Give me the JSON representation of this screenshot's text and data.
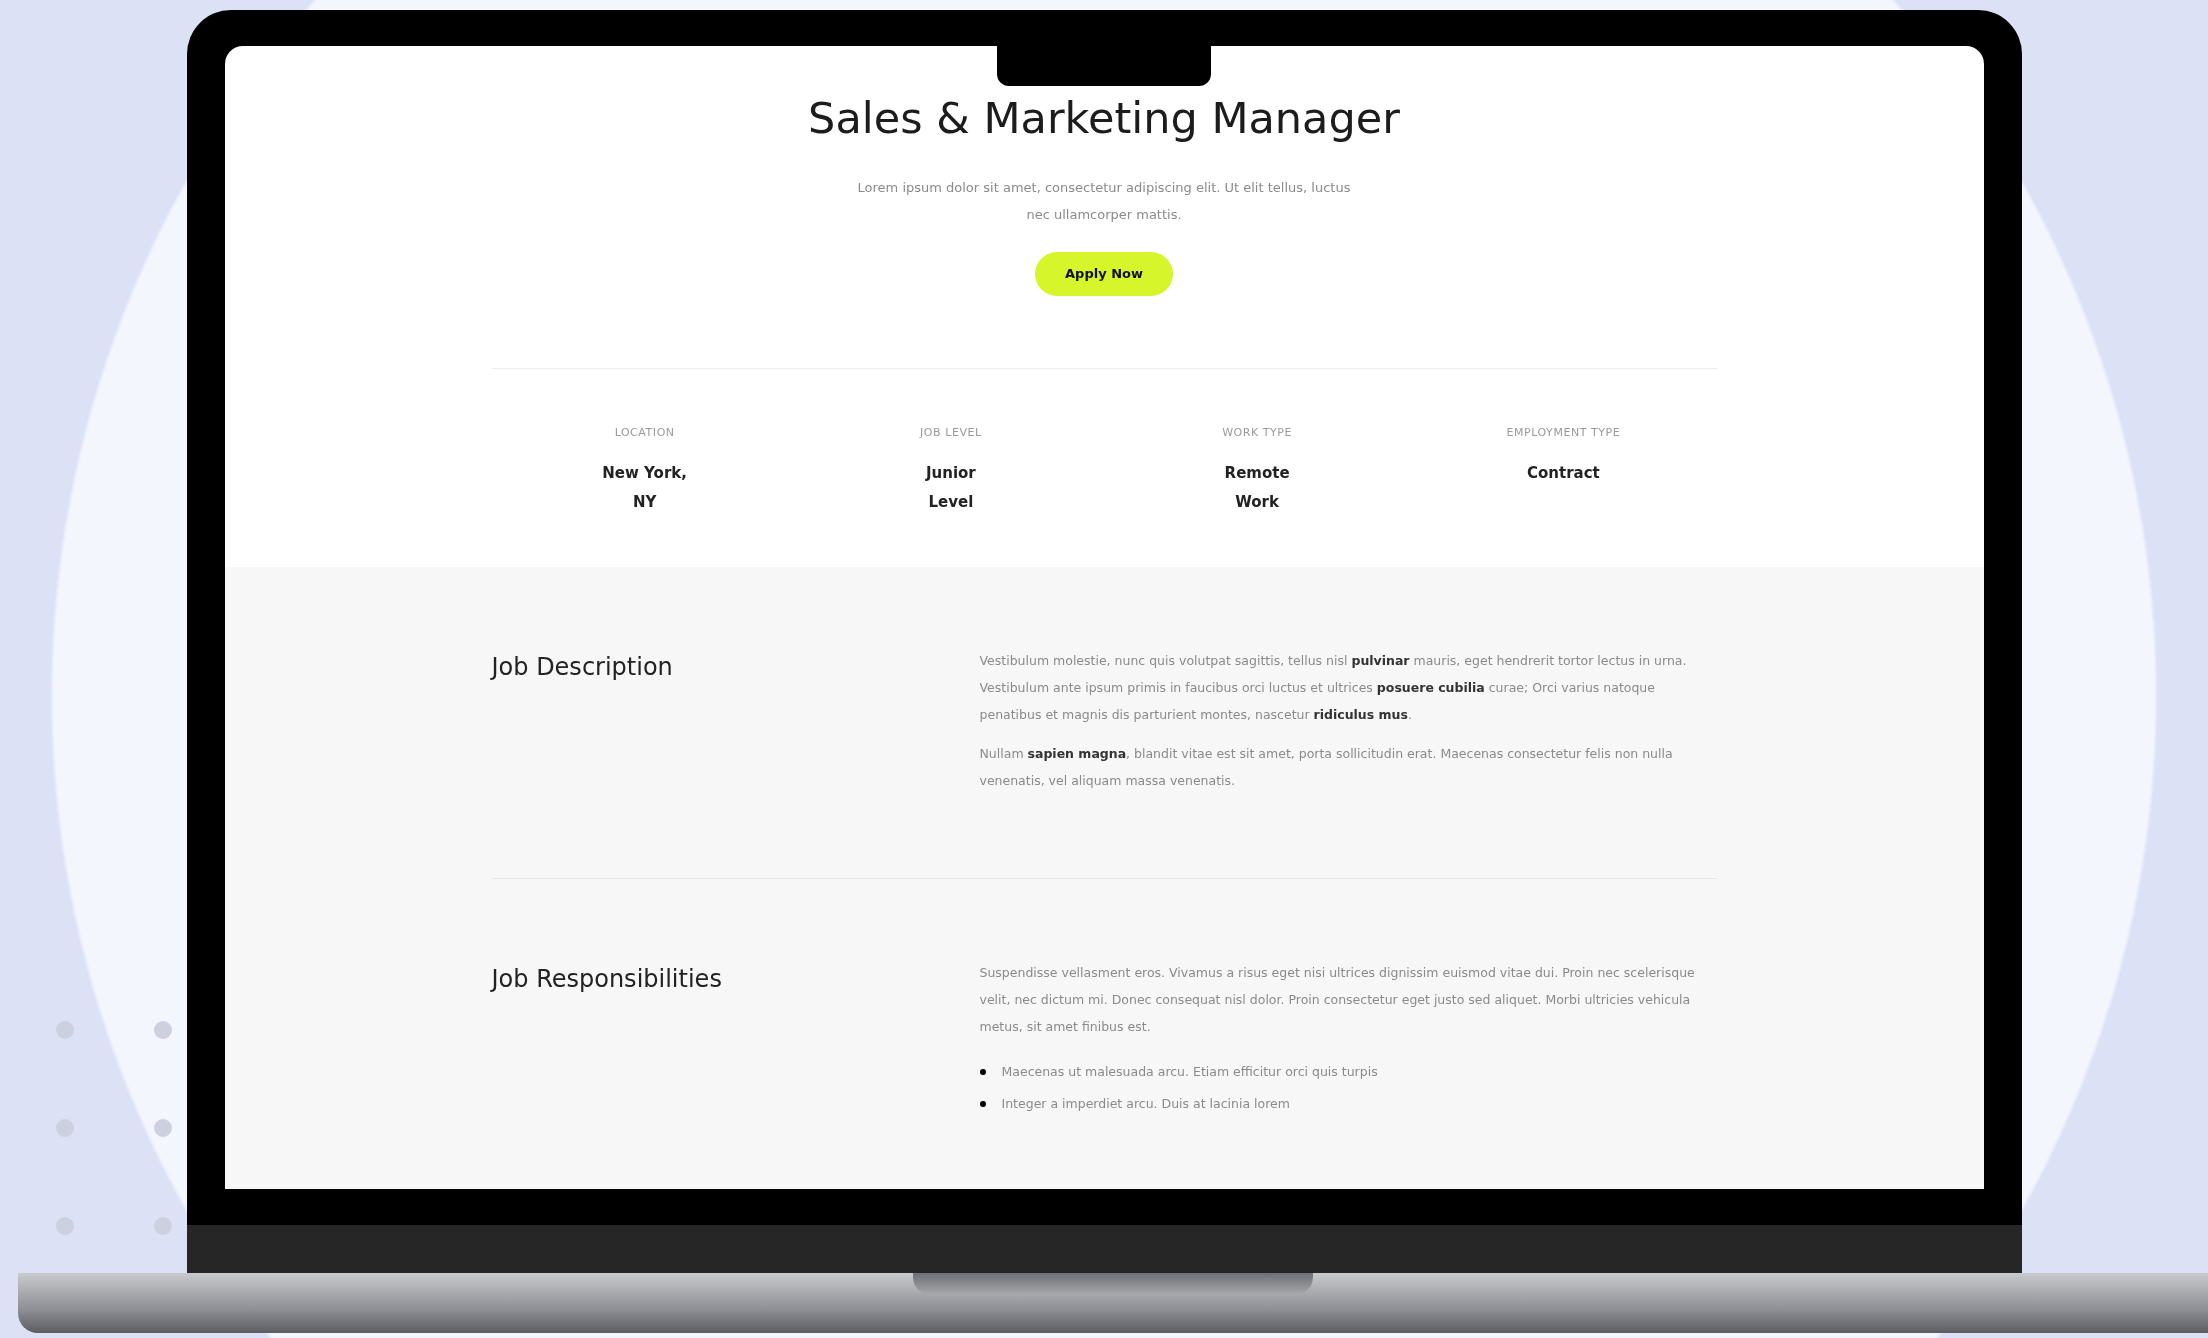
{
  "page": {
    "title": "Sales & Marketing Manager",
    "intro": "Lorem ipsum dolor sit amet, consectetur adipiscing elit. Ut elit tellus, luctus nec ullamcorper mattis.",
    "apply_button": "Apply Now"
  },
  "job_facts": [
    {
      "label": "LOCATION",
      "value": "New York, NY"
    },
    {
      "label": "JOB LEVEL",
      "value": "Junior Level"
    },
    {
      "label": "WORK TYPE",
      "value": "Remote Work"
    },
    {
      "label": "EMPLOYMENT TYPE",
      "value": "Contract"
    }
  ],
  "sections": [
    {
      "heading": "Job Description",
      "paragraphs": [
        "Vestibulum molestie, nunc quis volutpat sagittis, tellus nisl **pulvinar** mauris, eget hendrerit tortor lectus in urna. Vestibulum ante ipsum primis in faucibus orci luctus et ultrices **posuere cubilia** curae; Orci varius natoque penatibus et magnis dis parturient montes, nascetur **ridiculus mus**.",
        "Nullam **sapien magna**, blandit vitae est sit amet, porta sollicitudin erat. Maecenas consectetur felis non nulla venenatis, vel aliquam massa venenatis."
      ]
    },
    {
      "heading": "Job Responsibilities",
      "paragraphs": [
        "Suspendisse vellasment eros. Vivamus a risus eget nisi ultrices dignissim euismod vitae dui. Proin nec scelerisque velit, nec dictum mi. Donec consequat nisl dolor. Proin consectetur eget justo sed aliquet. Morbi ultricies vehicula metus, sit amet finibus est."
      ],
      "bullets": [
        "Maecenas ut malesuada arcu. Etiam efficitur orci quis turpis",
        "Integer a imperdiet arcu. Duis at lacinia lorem"
      ]
    }
  ]
}
